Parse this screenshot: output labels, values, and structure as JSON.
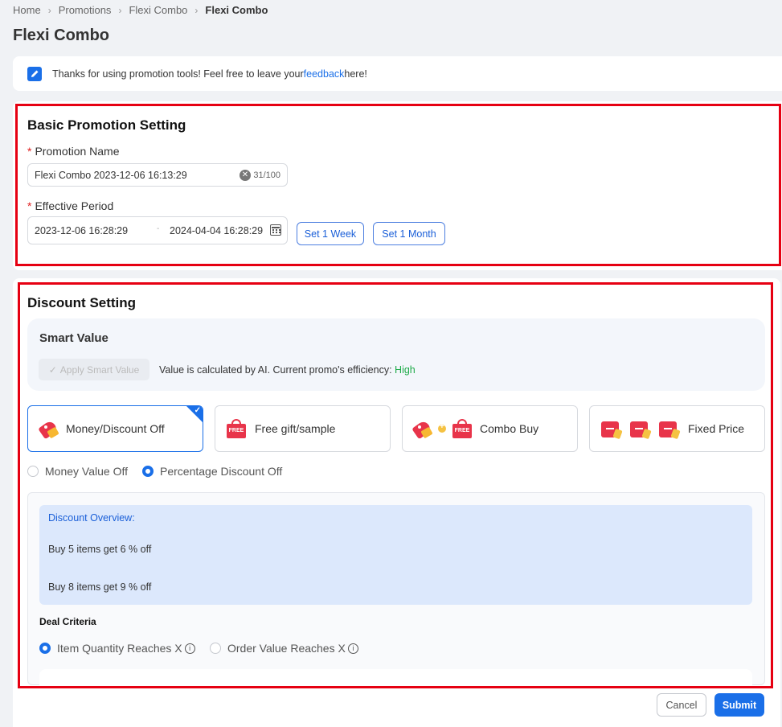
{
  "breadcrumb": [
    "Home",
    "Promotions",
    "Flexi Combo",
    "Flexi Combo"
  ],
  "page_title": "Flexi Combo",
  "feedback": {
    "before": "Thanks for using promotion tools! Feel free to leave your ",
    "link": "feedback",
    "after": " here!"
  },
  "basic": {
    "title": "Basic Promotion Setting",
    "name_label": "Promotion Name",
    "name_value": "Flexi Combo 2023-12-06 16:13:29",
    "name_count": "31/100",
    "period_label": "Effective Period",
    "start_date": "2023-12-06 16:28:29",
    "end_date": "2024-04-04 16:28:29",
    "set_week": "Set 1 Week",
    "set_month": "Set 1 Month"
  },
  "discount": {
    "title": "Discount Setting",
    "smart_title": "Smart Value",
    "apply_smart": "Apply Smart Value",
    "smart_text": "Value is calculated by AI. Current promo's efficiency: ",
    "efficiency": "High",
    "types": [
      "Money/Discount Off",
      "Free gift/sample",
      "Combo Buy",
      "Fixed Price"
    ],
    "selected_type": "Money/Discount Off",
    "mode_options": [
      "Money Value Off",
      "Percentage Discount Off"
    ],
    "selected_mode": "Percentage Discount Off",
    "overview_title": "Discount Overview:",
    "overview_lines": [
      "Buy 5 items get 6 % off",
      "Buy 8 items get 9 % off"
    ],
    "deal_title": "Deal Criteria",
    "criteria": [
      "Item Quantity Reaches X",
      "Order Value Reaches X"
    ],
    "selected_criteria": "Item Quantity Reaches X"
  },
  "footer": {
    "cancel": "Cancel",
    "submit": "Submit"
  },
  "colors": {
    "accent": "#1a6fe8",
    "highlight_box": "#e60012",
    "efficiency_green": "#1eab49"
  }
}
